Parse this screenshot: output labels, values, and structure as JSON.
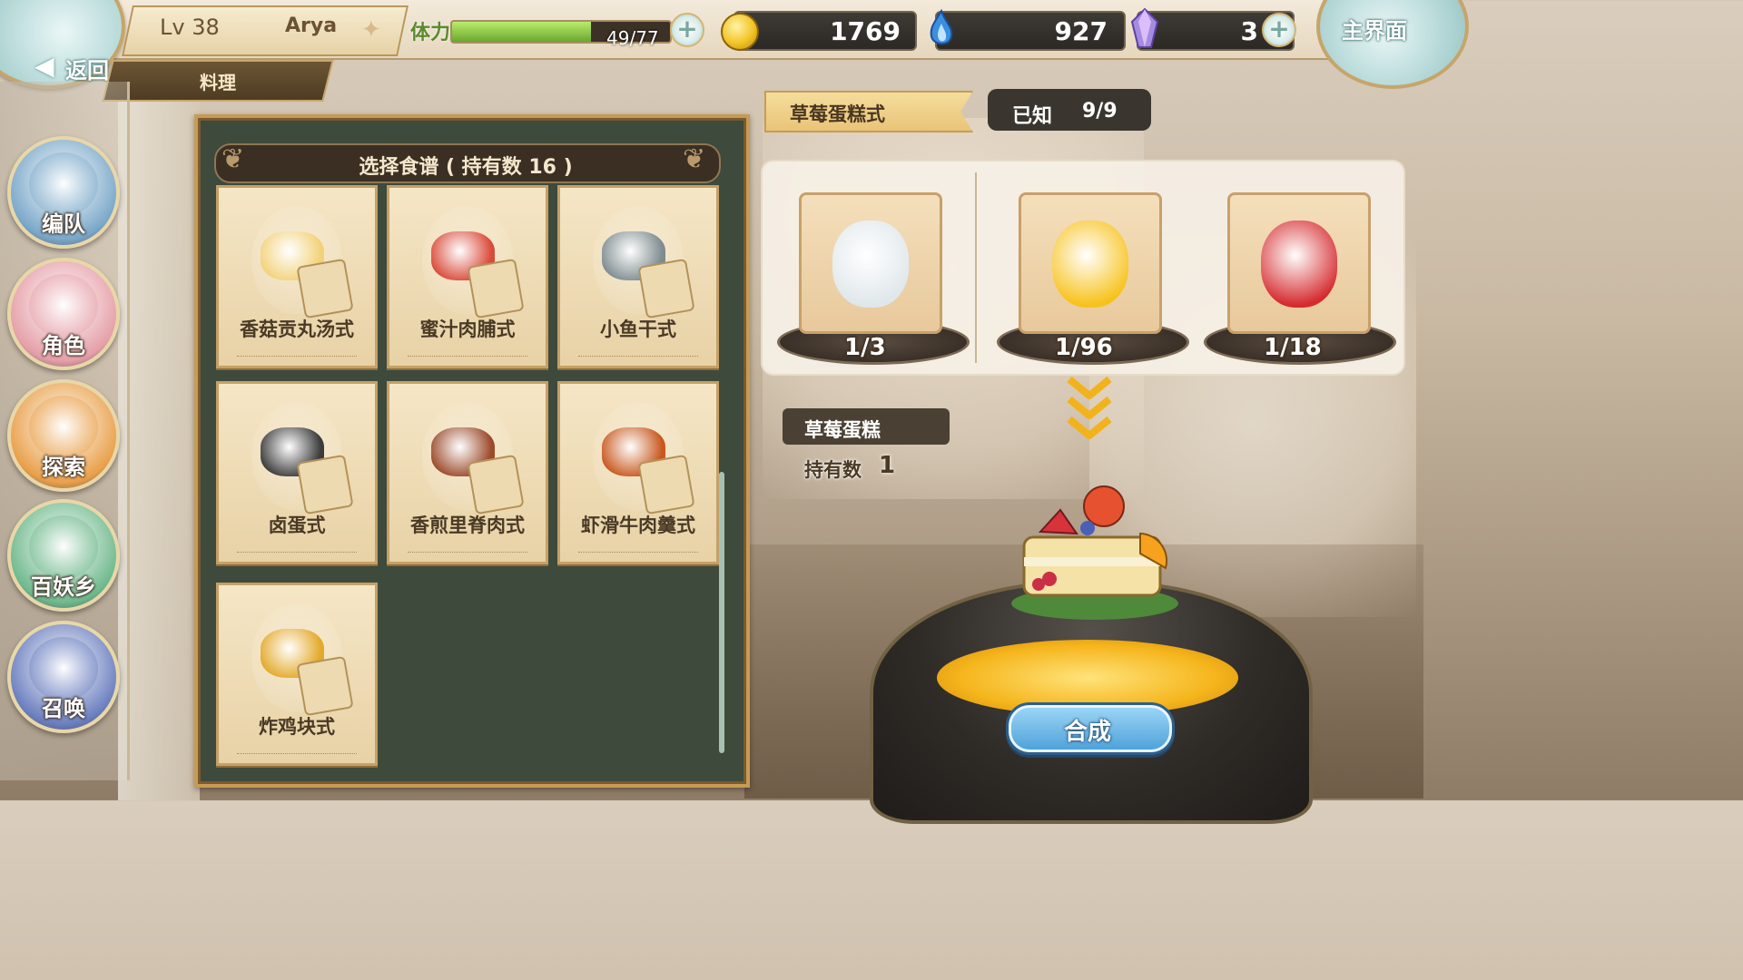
{
  "header": {
    "back_label": "返回",
    "level": "Lv 38",
    "player_name": "Arya",
    "section": "料理",
    "home_label": "主界面"
  },
  "resources": {
    "stamina_label": "体力",
    "stamina_text": "49/77",
    "stamina_fraction": 0.636,
    "gold": "1769",
    "gem": "927",
    "crystal": "3"
  },
  "nav": [
    {
      "label": "编队",
      "icon": "party-icon",
      "color": "#7aa8c9"
    },
    {
      "label": "角色",
      "icon": "character-icon",
      "color": "#e59fa8"
    },
    {
      "label": "探索",
      "icon": "explore-icon",
      "color": "#e9a04a"
    },
    {
      "label": "百妖乡",
      "icon": "village-icon",
      "color": "#6fb98d"
    },
    {
      "label": "召唤",
      "icon": "summon-icon",
      "color": "#6b7fbf"
    }
  ],
  "recipe_list": {
    "title": "选择食谱 ( 持有数 16 )",
    "items": [
      {
        "name": "香菇贡丸汤式",
        "icon": "meatball-soup-icon",
        "color": "#f2d27a"
      },
      {
        "name": "蜜汁肉脯式",
        "icon": "honey-jerky-icon",
        "color": "#d94a3a"
      },
      {
        "name": "小鱼干式",
        "icon": "dried-fish-icon",
        "color": "#7f8c8f"
      },
      {
        "name": "卤蛋式",
        "icon": "braised-egg-icon",
        "color": "#3b3b3b"
      },
      {
        "name": "香煎里脊肉式",
        "icon": "pork-tenderloin-icon",
        "color": "#9b4a2a"
      },
      {
        "name": "虾滑牛肉羹式",
        "icon": "shrimp-beef-soup-icon",
        "color": "#c8581f"
      },
      {
        "name": "炸鸡块式",
        "icon": "fried-chicken-icon",
        "color": "#e3a92a"
      }
    ]
  },
  "detail": {
    "dish_title": "草莓蛋糕式",
    "known_label": "已知",
    "known_value": "9/9",
    "ingredients": [
      {
        "count": "1/3",
        "icon": "milk-jar-icon",
        "color": "#dfe7ea"
      },
      {
        "count": "1/96",
        "icon": "fried-egg-icon",
        "color": "#f7c21a"
      },
      {
        "count": "1/18",
        "icon": "strawberry-icon",
        "color": "#d52a2e"
      }
    ],
    "result_name": "草莓蛋糕",
    "owned_label": "持有数",
    "owned_value": "1",
    "craft_label": "合成"
  }
}
